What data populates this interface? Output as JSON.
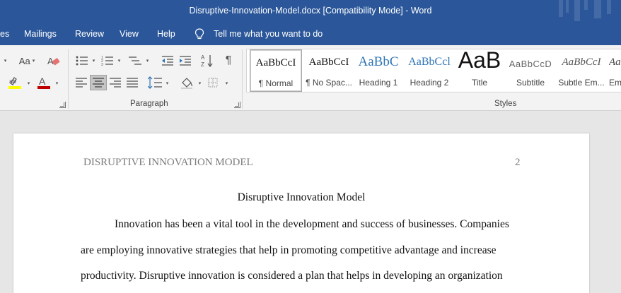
{
  "window": {
    "title": "Disruptive-Innovation-Model.docx [Compatibility Mode]  -  Word"
  },
  "tabs": {
    "partial": "es",
    "mailings": "Mailings",
    "review": "Review",
    "view": "View",
    "help": "Help",
    "tell_me": "Tell me what you want to do"
  },
  "ribbon": {
    "font_aa": "Aa",
    "paragraph_label": "Paragraph",
    "styles_label": "Styles",
    "pilcrow": "¶",
    "styles": [
      {
        "preview": "AaBbCcI",
        "name": "¶ Normal"
      },
      {
        "preview": "AaBbCcI",
        "name": "¶ No Spac..."
      },
      {
        "preview": "AaBbC",
        "name": "Heading 1"
      },
      {
        "preview": "AaBbCcl",
        "name": "Heading 2"
      },
      {
        "preview": "AaB",
        "name": "Title"
      },
      {
        "preview": "AaBbCcD",
        "name": "Subtitle"
      },
      {
        "preview": "AaBbCcI",
        "name": "Subtle Em..."
      },
      {
        "preview": "Aa",
        "name": "Em"
      }
    ]
  },
  "document": {
    "header": "DISRUPTIVE INNOVATION MODEL",
    "page_number": "2",
    "title": "Disruptive Innovation Model",
    "lines": [
      "Innovation has been a vital tool in the development and success of businesses. Companies",
      "are employing innovative strategies that help in promoting competitive advantage and increase",
      "productivity. Disruptive innovation is considered a plan that helps in developing an organization"
    ]
  },
  "colors": {
    "title_bar": "#2b579a",
    "ribbon": "#f3f3f3",
    "canvas": "#e6e6e6",
    "highlight_yellow": "#ffff00",
    "font_color_red": "#c00000",
    "heading_blue": "#2e74b5"
  }
}
